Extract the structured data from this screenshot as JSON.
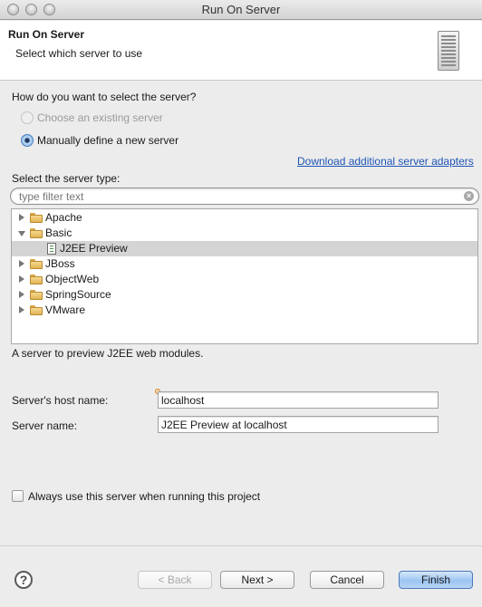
{
  "window": {
    "title": "Run On Server"
  },
  "header": {
    "title": "Run On Server",
    "subtitle": "Select which server to use",
    "icon": "server-icon"
  },
  "selection": {
    "question": "How do you want to select the server?",
    "option_existing": "Choose an existing server",
    "option_existing_enabled": false,
    "option_new": "Manually define a new server",
    "selected": "new"
  },
  "server_type": {
    "download_link": "Download additional server adapters",
    "label": "Select the server type:",
    "filter_placeholder": "type filter text",
    "tree": [
      {
        "label": "Apache",
        "expanded": false,
        "children": []
      },
      {
        "label": "Basic",
        "expanded": true,
        "children": [
          {
            "label": "J2EE Preview",
            "selected": true
          }
        ]
      },
      {
        "label": "JBoss",
        "expanded": false,
        "children": []
      },
      {
        "label": "ObjectWeb",
        "expanded": false,
        "children": []
      },
      {
        "label": "SpringSource",
        "expanded": false,
        "children": []
      },
      {
        "label": "VMware",
        "expanded": false,
        "children": []
      }
    ],
    "description": "A server to preview J2EE web modules."
  },
  "form": {
    "host_label": "Server's host name:",
    "host_value": "localhost",
    "name_label": "Server name:",
    "name_value": "J2EE Preview at localhost"
  },
  "always_use": {
    "label": "Always use this server when running this project",
    "checked": false
  },
  "footer": {
    "help": "?",
    "back": "< Back",
    "back_enabled": false,
    "next": "Next >",
    "cancel": "Cancel",
    "finish": "Finish"
  }
}
